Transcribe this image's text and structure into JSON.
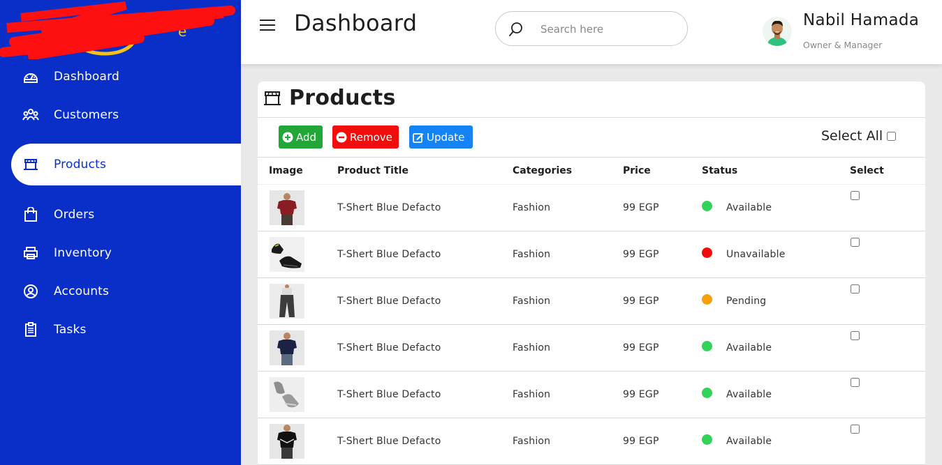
{
  "header": {
    "title": "Dashboard",
    "search_placeholder": "Search here",
    "user_name": "Nabil Hamada",
    "user_role": "Owner & Manager"
  },
  "sidebar": {
    "items": [
      {
        "label": "Dashboard",
        "icon": "dashboard-gauge-icon"
      },
      {
        "label": "Customers",
        "icon": "customers-group-icon"
      },
      {
        "label": "Products",
        "icon": "products-shop-icon",
        "active": true
      },
      {
        "label": "Orders",
        "icon": "shopping-bag-icon"
      },
      {
        "label": "Inventory",
        "icon": "inventory-printer-icon"
      },
      {
        "label": "Accounts",
        "icon": "account-user-icon"
      },
      {
        "label": "Tasks",
        "icon": "clipboard-icon"
      }
    ]
  },
  "products": {
    "title": "Products",
    "buttons": {
      "add": "Add",
      "remove": "Remove",
      "update": "Update"
    },
    "select_all": "Select All",
    "columns": [
      "Image",
      "Product Title",
      "Categories",
      "Price",
      "Status",
      "Select"
    ],
    "rows": [
      {
        "image": "red-tshirt",
        "title": "T-Shert Blue Defacto",
        "category": "Fashion",
        "price": "99 EGP",
        "status": "Available",
        "status_color": "#33d35a"
      },
      {
        "image": "black-sneakers",
        "title": "T-Shert Blue Defacto",
        "category": "Fashion",
        "price": "99 EGP",
        "status": "Unavailable",
        "status_color": "#f20d0d"
      },
      {
        "image": "grey-pants",
        "title": "T-Shert Blue Defacto",
        "category": "Fashion",
        "price": "99 EGP",
        "status": "Pending",
        "status_color": "#f5a10a"
      },
      {
        "image": "navy-tshirt",
        "title": "T-Shert Blue Defacto",
        "category": "Fashion",
        "price": "99 EGP",
        "status": "Available",
        "status_color": "#33d35a"
      },
      {
        "image": "grey-sneakers",
        "title": "T-Shert Blue Defacto",
        "category": "Fashion",
        "price": "99 EGP",
        "status": "Available",
        "status_color": "#33d35a"
      },
      {
        "image": "black-tshirt",
        "title": "T-Shert Blue Defacto",
        "category": "Fashion",
        "price": "99 EGP",
        "status": "Available",
        "status_color": "#33d35a"
      }
    ]
  },
  "colors": {
    "sidebar": "#0a2fc8",
    "add": "#22a637",
    "remove": "#f20d0d",
    "update": "#1683f4"
  }
}
